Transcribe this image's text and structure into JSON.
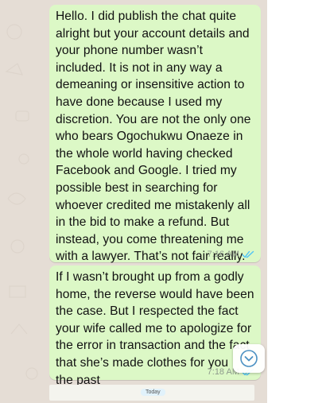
{
  "messages": [
    {
      "text": "Hello. I did publish the chat quite\nalright but your account details and\nyour phone number wasn’t\nincluded. It is not in any way a\ndemeaning or insensitive action to\nhave done because I used my\ndiscretion. You are not the only one\nwho bears Ogochukwu Onaeze in\nthe whole world having checked\nFacebook and Google. I tried my\npossible best in searching for\nwhoever credited me mistakenly all\nin the bid to make a refund. But\ninstead, you come threatening me\nwith a lawyer. That’s not fair really.",
      "time": "7:16 AM",
      "status": "read"
    },
    {
      "text": "If I wasn’t brought up from a godly\nhome, the reverse would have been\nthe case. But I respected the fact\nyour wife called me to apologize for\nthe error in transaction and the fact\nthat she’s made clothes for you\nthe past",
      "time": "7:18 AM",
      "status": "read"
    }
  ],
  "date_divider": "Today",
  "icons": {
    "read_ticks": "double-check-icon",
    "scroll_down": "chevron-down-circle-icon"
  },
  "colors": {
    "chat_background": "#e5ddd5",
    "outgoing_bubble": "#dcf8c6",
    "read_tick": "#4fc3f7",
    "scroll_icon": "#4a90c2"
  }
}
